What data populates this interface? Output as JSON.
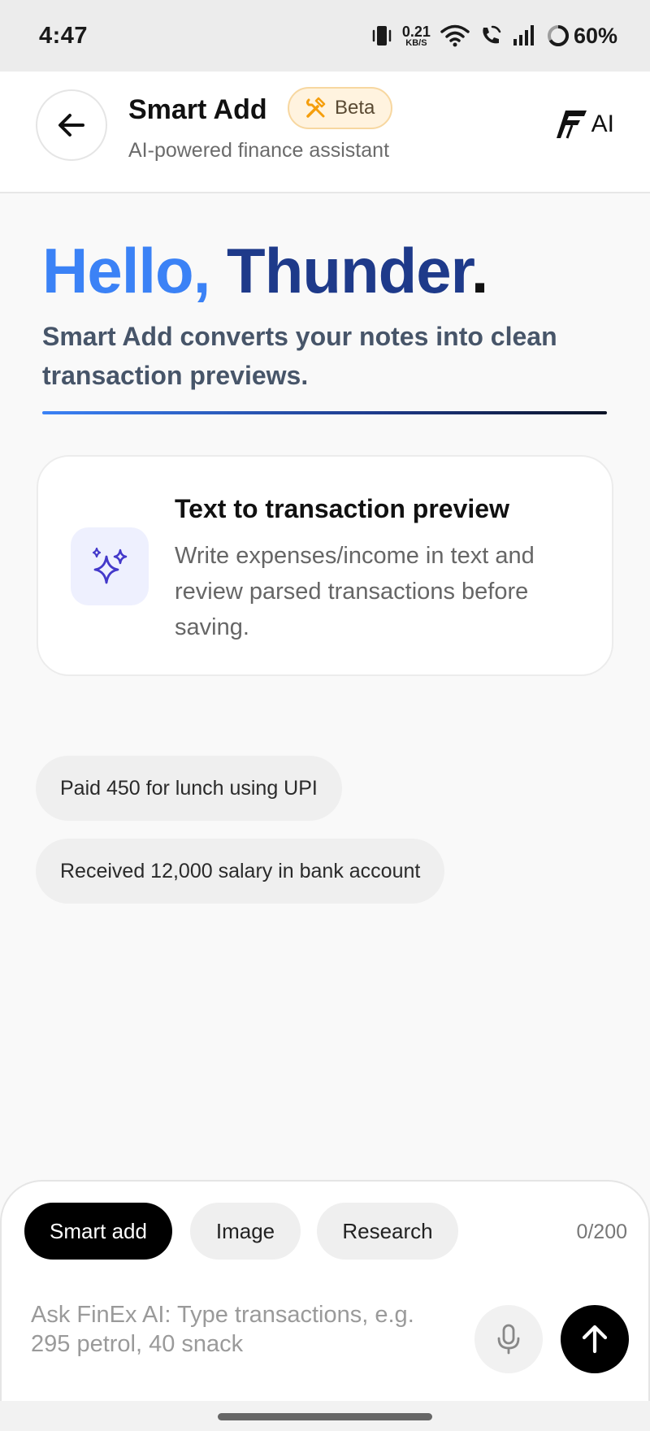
{
  "status_bar": {
    "time": "4:47",
    "net_speed_value": "0.21",
    "net_speed_unit": "KB/S",
    "battery": "60%",
    "icons": [
      "vibrate-icon",
      "wifi-icon",
      "wifi-call-icon",
      "signal-icon",
      "battery-icon"
    ]
  },
  "header": {
    "title": "Smart Add",
    "badge": "Beta",
    "subtitle": "AI-powered finance assistant",
    "brand_text": "AI"
  },
  "greeting": {
    "hello": "Hello,",
    "name": "Thunder",
    "dot": ".",
    "description": "Smart Add converts your notes into clean transaction previews."
  },
  "feature_card": {
    "title": "Text to transaction preview",
    "description": "Write expenses/income in text and review parsed transactions before saving."
  },
  "suggestions": [
    "Paid 450 for lunch using UPI",
    "Received 12,000 salary in bank account"
  ],
  "composer": {
    "modes": [
      "Smart add",
      "Image",
      "Research"
    ],
    "active_mode": "Smart add",
    "char_count": "0/200",
    "placeholder": "Ask FinEx AI: Type transactions, e.g. 295 petrol, 40 snack"
  },
  "colors": {
    "hello_blue": "#3b82f6",
    "name_navy": "#1e3a8a",
    "beta_bg": "#fff3df",
    "feature_icon": "#4338ca"
  }
}
